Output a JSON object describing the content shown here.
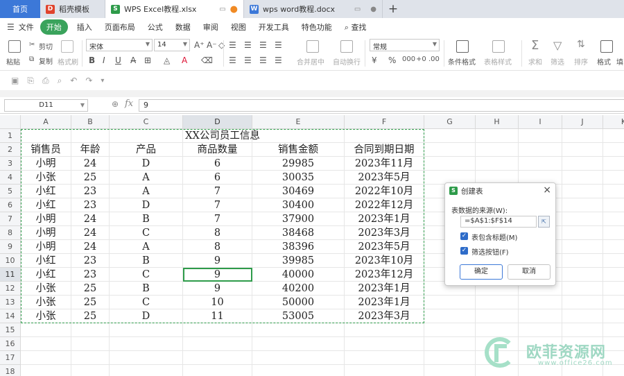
{
  "tabs": {
    "home": "首页",
    "items": [
      {
        "label": "稻壳模板",
        "icon": "wps-docer-icon"
      },
      {
        "label": "WPS Excel教程.xlsx",
        "icon": "wps-sheet-icon",
        "active": true
      },
      {
        "label": "wps word教程.docx",
        "icon": "wps-word-icon"
      }
    ],
    "new_tab": "+"
  },
  "menu": {
    "file": "文件",
    "items": [
      "开始",
      "插入",
      "页面布局",
      "公式",
      "数据",
      "审阅",
      "视图",
      "开发工具",
      "特色功能"
    ],
    "search": "查找"
  },
  "ribbon": {
    "paste": "粘贴",
    "cut": "剪切",
    "copy": "复制",
    "format_painter": "格式刷",
    "font_name": "宋体",
    "font_size": "14",
    "bold": "B",
    "italic": "I",
    "underline": "U",
    "merge_center": "合并居中",
    "wrap_text": "自动换行",
    "number_format": "常规",
    "conditional_format": "条件格式",
    "table_style": "表格样式",
    "sum": "求和",
    "filter": "筛选",
    "sort": "排序",
    "format": "格式",
    "fill": "填"
  },
  "formula_bar": {
    "name_box": "D11",
    "fx": "fx",
    "value": "9"
  },
  "sheet": {
    "columns": [
      "A",
      "B",
      "C",
      "D",
      "E",
      "F",
      "G",
      "H",
      "I",
      "J",
      "K"
    ],
    "rows": [
      "1",
      "2",
      "3",
      "4",
      "5",
      "6",
      "7",
      "8",
      "9",
      "10",
      "11",
      "12",
      "13",
      "14",
      "15",
      "16",
      "17",
      "18"
    ],
    "title": "XX公司员工信息",
    "headers": [
      "销售员",
      "年龄",
      "产品",
      "商品数量",
      "销售金额",
      "合同到期日期"
    ],
    "data": [
      [
        "小明",
        "24",
        "D",
        "6",
        "29985",
        "2023年11月"
      ],
      [
        "小张",
        "25",
        "A",
        "6",
        "30035",
        "2023年5月"
      ],
      [
        "小红",
        "23",
        "A",
        "7",
        "30469",
        "2022年10月"
      ],
      [
        "小红",
        "23",
        "D",
        "7",
        "30400",
        "2022年12月"
      ],
      [
        "小明",
        "24",
        "B",
        "7",
        "37900",
        "2023年1月"
      ],
      [
        "小明",
        "24",
        "C",
        "8",
        "38468",
        "2023年3月"
      ],
      [
        "小明",
        "24",
        "A",
        "8",
        "38396",
        "2023年5月"
      ],
      [
        "小红",
        "23",
        "B",
        "9",
        "39985",
        "2023年10月"
      ],
      [
        "小红",
        "23",
        "C",
        "9",
        "40000",
        "2023年12月"
      ],
      [
        "小张",
        "25",
        "B",
        "9",
        "40200",
        "2023年1月"
      ],
      [
        "小张",
        "25",
        "C",
        "10",
        "50000",
        "2023年1月"
      ],
      [
        "小张",
        "25",
        "D",
        "11",
        "53005",
        "2023年3月"
      ]
    ],
    "selected_cell": "D11"
  },
  "dialog": {
    "title": "创建表",
    "close": "×",
    "source_label": "表数据的来源(W):",
    "source_value": "=$A$1:$F$14",
    "has_header_label": "表包含标题(M)",
    "has_header_checked": true,
    "filter_button_label": "筛选按钮(F)",
    "filter_button_checked": true,
    "ok": "确定",
    "cancel": "取消"
  },
  "watermark": {
    "text": "欧菲资源网",
    "url": "www.office26.com"
  },
  "colors": {
    "accent_green": "#2e9b4a",
    "tab_blue": "#3c78d8"
  }
}
